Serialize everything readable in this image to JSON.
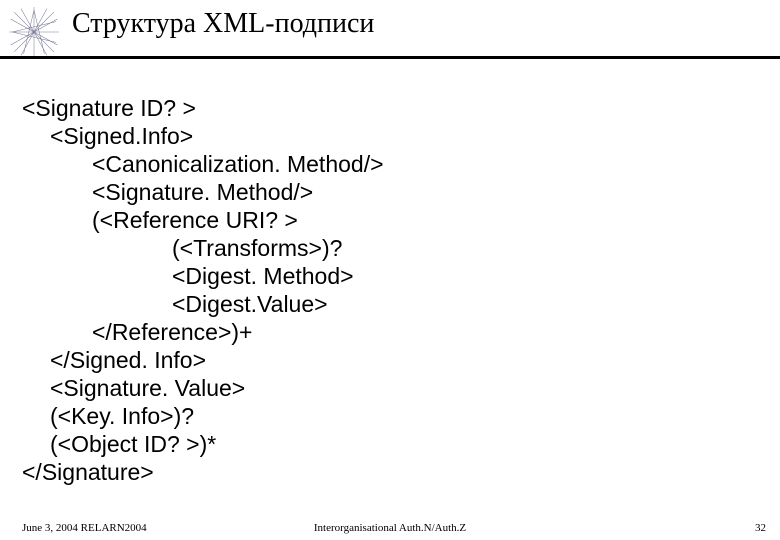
{
  "title": "Структура XML-подписи",
  "code": {
    "l1": "<Signature ID? >",
    "l2": "<Signed.Info>",
    "l3": "<Canonicalization. Method/>",
    "l4": "<Signature. Method/>",
    "l5": "(<Reference URI? >",
    "l6": "(<Transforms>)?",
    "l7": "<Digest. Method>",
    "l8": "<Digest.Value>",
    "l9": "</Reference>)+",
    "l10": "</Signed. Info>",
    "l11": "<Signature. Value>",
    "l12": "(<Key. Info>)?",
    "l13": "(<Object ID? >)*",
    "l14": "</Signature>"
  },
  "footer": {
    "left": "June 3, 2004 RELARN2004",
    "center": "Interorganisational Auth.N/Auth.Z",
    "right": "32"
  },
  "icons": {
    "star": "starburst-icon"
  }
}
